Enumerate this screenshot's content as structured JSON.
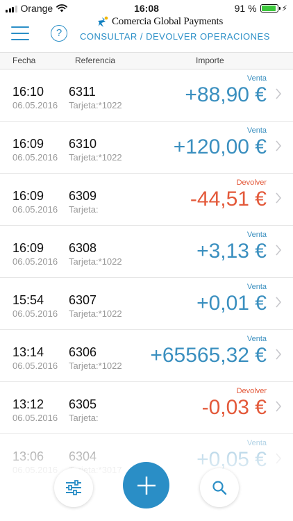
{
  "statusbar": {
    "carrier": "Orange",
    "time": "16:08",
    "battery_text": "91 %",
    "battery_level": 0.91
  },
  "header": {
    "brand": "Comercia Global Payments",
    "help_label": "?",
    "title": "CONSULTAR / DEVOLVER OPERACIONES"
  },
  "columns": {
    "fecha": "Fecha",
    "referencia": "Referencia",
    "importe": "Importe"
  },
  "operations": [
    {
      "time": "16:10",
      "date": "06.05.2016",
      "ref": "6311",
      "card": "Tarjeta:*1022",
      "type": "Venta",
      "amount": "+88,90 €",
      "kind": "pos"
    },
    {
      "time": "16:09",
      "date": "06.05.2016",
      "ref": "6310",
      "card": "Tarjeta:*1022",
      "type": "Venta",
      "amount": "+120,00 €",
      "kind": "pos"
    },
    {
      "time": "16:09",
      "date": "06.05.2016",
      "ref": "6309",
      "card": "Tarjeta:",
      "type": "Devolver",
      "amount": "-44,51 €",
      "kind": "neg"
    },
    {
      "time": "16:09",
      "date": "06.05.2016",
      "ref": "6308",
      "card": "Tarjeta:*1022",
      "type": "Venta",
      "amount": "+3,13 €",
      "kind": "pos"
    },
    {
      "time": "15:54",
      "date": "06.05.2016",
      "ref": "6307",
      "card": "Tarjeta:*1022",
      "type": "Venta",
      "amount": "+0,01 €",
      "kind": "pos"
    },
    {
      "time": "13:14",
      "date": "06.05.2016",
      "ref": "6306",
      "card": "Tarjeta:*1022",
      "type": "Venta",
      "amount": "+65565,32 €",
      "kind": "pos"
    },
    {
      "time": "13:12",
      "date": "06.05.2016",
      "ref": "6305",
      "card": "Tarjeta:",
      "type": "Devolver",
      "amount": "-0,03 €",
      "kind": "neg"
    },
    {
      "time": "13:06",
      "date": "06.05.2016",
      "ref": "6304",
      "card": "Tarjeta:*3017",
      "type": "Venta",
      "amount": "+0,05 €",
      "kind": "pos"
    }
  ],
  "toolbar": {
    "filter_icon": "sliders-icon",
    "add_icon": "plus-icon",
    "search_icon": "search-icon"
  },
  "colors": {
    "accent": "#2a8ec6",
    "positive": "#3a8fbf",
    "negative": "#e3593a"
  }
}
